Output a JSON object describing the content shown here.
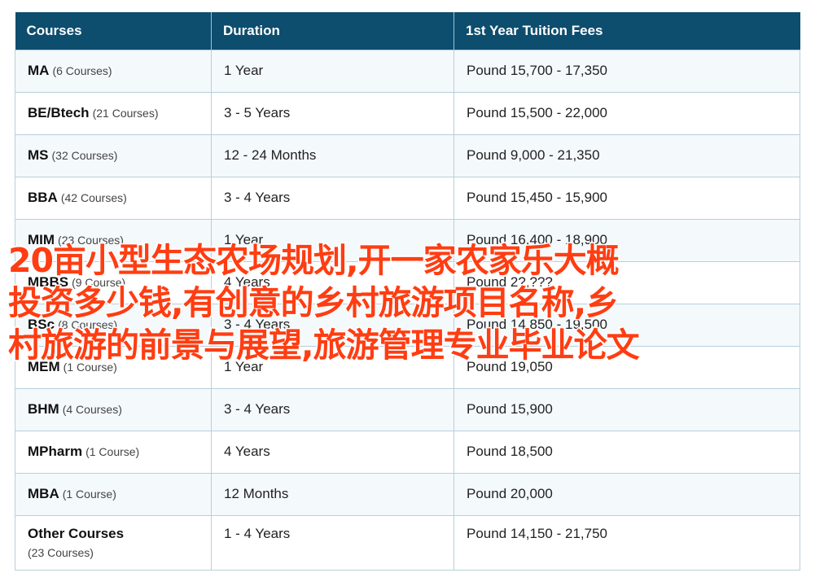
{
  "table": {
    "headers": [
      "Courses",
      "Duration",
      "1st Year Tuition Fees"
    ],
    "rows": [
      {
        "course": "MA",
        "count": "(6 Courses)",
        "duration": "1 Year",
        "fees": "Pound 15,700 - 17,350"
      },
      {
        "course": "BE/Btech",
        "count": "(21 Courses)",
        "duration": "3 - 5 Years",
        "fees": "Pound 15,500 - 22,000"
      },
      {
        "course": "MS",
        "count": "(32 Courses)",
        "duration": "12 - 24 Months",
        "fees": "Pound 9,000 - 21,350"
      },
      {
        "course": "BBA",
        "count": "(42 Courses)",
        "duration": "3 - 4 Years",
        "fees": "Pound 15,450 - 15,900"
      },
      {
        "course": "MIM",
        "count": "(23 Courses)",
        "duration": "1 Year",
        "fees": "Pound 16,400 - 18,900"
      },
      {
        "course": "MBBS",
        "count": "(9 Course)",
        "duration": "4 Years",
        "fees": "Pound 2?,???"
      },
      {
        "course": "BSc",
        "count": "(8 Courses)",
        "duration": "3 - 4 Years",
        "fees": "Pound 14,850 - 19,500"
      },
      {
        "course": "MEM",
        "count": "(1 Course)",
        "duration": "1 Year",
        "fees": "Pound 19,050"
      },
      {
        "course": "BHM",
        "count": "(4 Courses)",
        "duration": "3 - 4 Years",
        "fees": "Pound 15,900"
      },
      {
        "course": "MPharm",
        "count": "(1 Course)",
        "duration": "4 Years",
        "fees": "Pound 18,500"
      },
      {
        "course": "MBA",
        "count": "(1 Course)",
        "duration": "12 Months",
        "fees": "Pound 20,000"
      },
      {
        "course": "Other Courses",
        "count": "(23 Courses)",
        "duration": "1 - 4 Years",
        "fees": "Pound 14,150 - 21,750"
      }
    ]
  },
  "overlay": {
    "lines": [
      "20亩小型生态农场规划,开一家农家乐大概",
      "投资多少钱,有创意的乡村旅游项目名称,乡",
      "村旅游的前景与展望,旅游管理专业毕业论文"
    ],
    "color": "#ff3d12"
  },
  "colors": {
    "header_bg": "#0d4d6e",
    "row_odd_bg": "#f4f9fc",
    "border": "#b9cfdb"
  }
}
